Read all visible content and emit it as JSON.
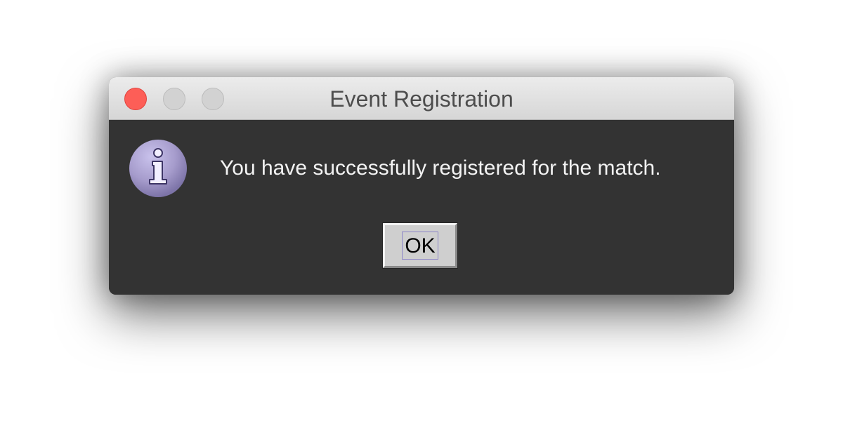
{
  "window": {
    "title": "Event Registration"
  },
  "message": {
    "text": "You have successfully registered for the match."
  },
  "buttons": {
    "ok_label": "OK"
  },
  "icons": {
    "window_controls": [
      "close-icon",
      "minimize-icon",
      "zoom-icon"
    ],
    "dialog_icon": "info-icon"
  },
  "colors": {
    "dialog_background": "#333333",
    "titlebar_background": "#e3e3e3",
    "close_button": "#fd5e57",
    "inactive_button": "#d2d2d2",
    "message_text": "#f2f2f2",
    "info_icon": "#a79fcc",
    "ok_button": "#cfcfcf"
  }
}
